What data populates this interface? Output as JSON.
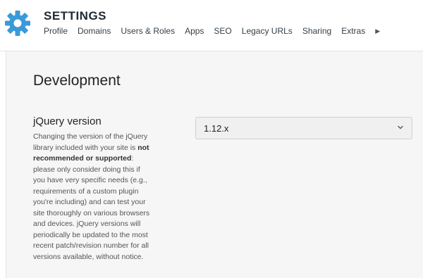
{
  "header": {
    "title": "SETTINGS",
    "icon": "gear-icon",
    "icon_color": "#3a9ad9",
    "nav": [
      {
        "label": "Profile"
      },
      {
        "label": "Domains"
      },
      {
        "label": "Users & Roles"
      },
      {
        "label": "Apps"
      },
      {
        "label": "SEO"
      },
      {
        "label": "Legacy URLs"
      },
      {
        "label": "Sharing"
      },
      {
        "label": "Extras"
      }
    ],
    "more_icon": "triangle-right-icon"
  },
  "section": {
    "title": "Development"
  },
  "jquery": {
    "label": "jQuery version",
    "help_pre": "Changing the version of the jQuery library included with your site is ",
    "help_bold": "not recommended or supported",
    "help_post": ": please only consider doing this if you have very specific needs (e.g., requirements of a custom plugin you're including) and can test your site thoroughly on various browsers and devices. jQuery versions will periodically be updated to the most recent patch/revision number for all versions available, without notice.",
    "selected": "1.12.x",
    "dropdown_icon": "chevron-down-icon"
  }
}
